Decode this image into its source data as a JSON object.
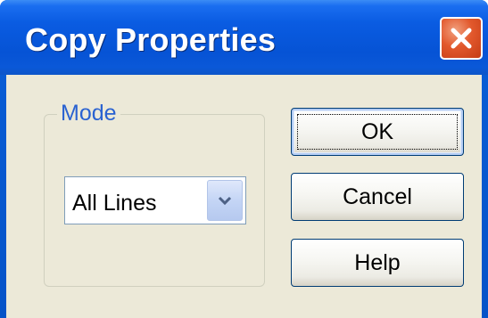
{
  "window": {
    "title": "Copy Properties",
    "close_icon": "close-icon"
  },
  "mode_group": {
    "label": "Mode",
    "dropdown": {
      "selected": "All Lines",
      "icon": "chevron-down-icon"
    }
  },
  "buttons": {
    "ok": "OK",
    "cancel": "Cancel",
    "help": "Help"
  },
  "colors": {
    "titlebar": "#0653d5",
    "close_button": "#e2582c",
    "group_label": "#2a62d1",
    "dialog_background": "#ece9d8"
  }
}
